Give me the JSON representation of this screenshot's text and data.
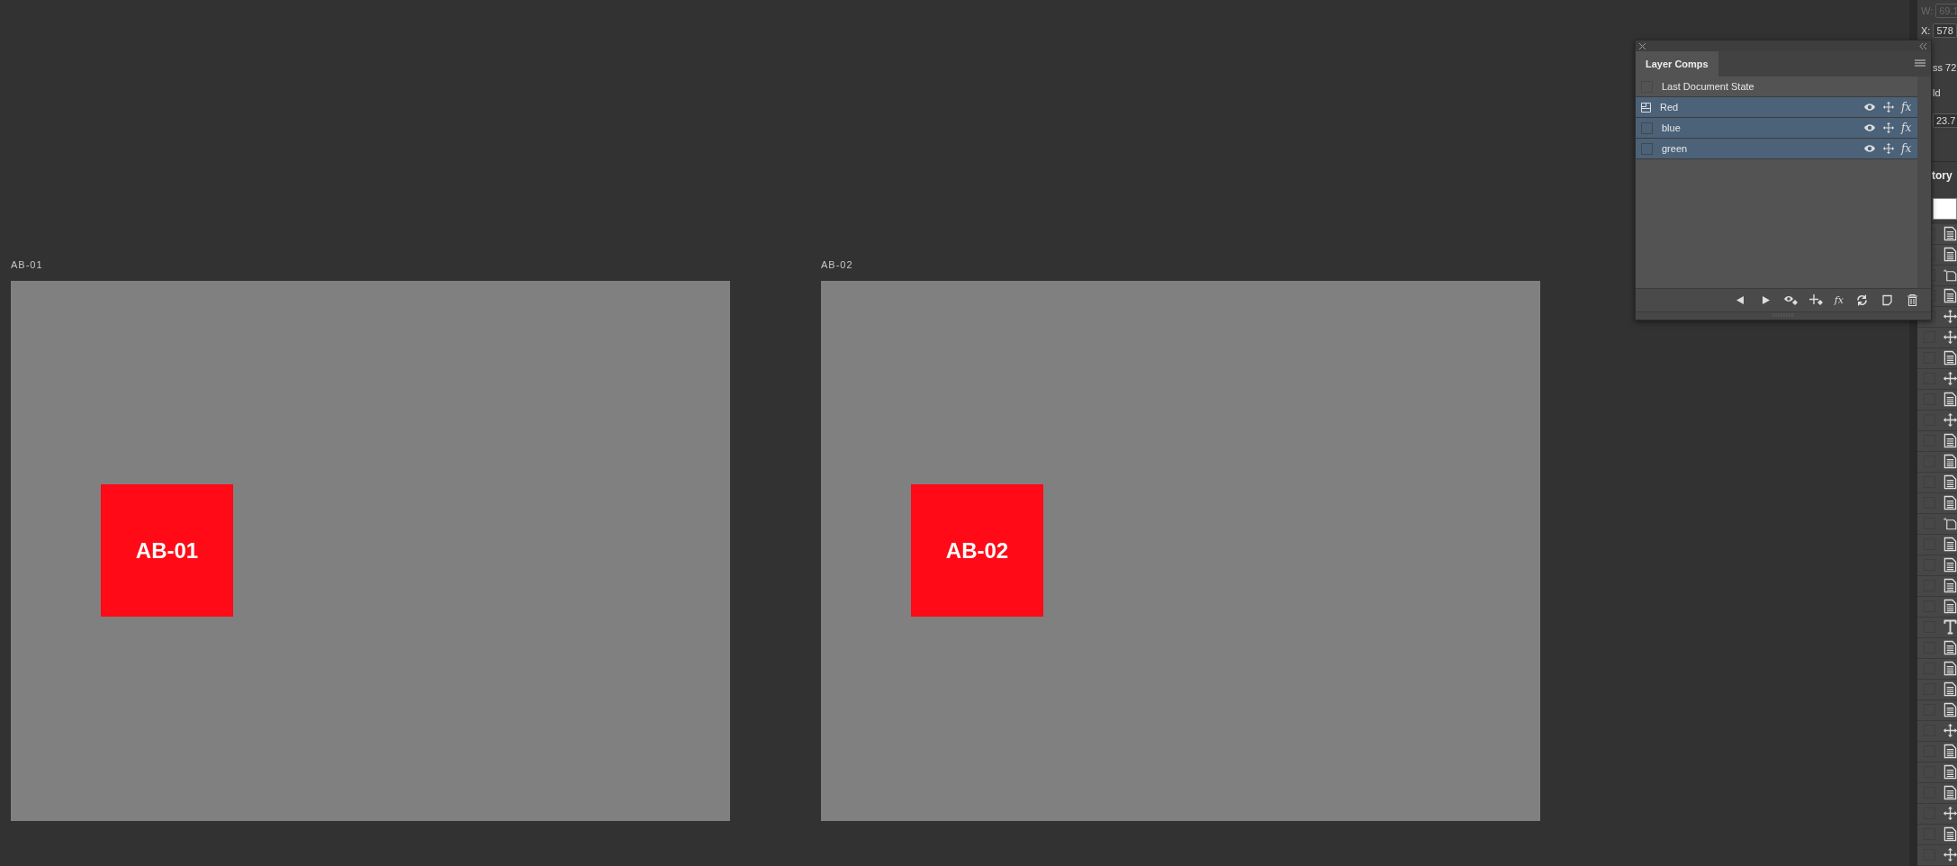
{
  "artboards": [
    {
      "label": "AB-01",
      "layer_text": "AB-01"
    },
    {
      "label": "AB-02",
      "layer_text": "AB-02"
    }
  ],
  "layer_comps_panel": {
    "tab": "Layer Comps",
    "footer_fx": "fx",
    "comps": [
      {
        "kind": "document_state",
        "name": "Last Document State",
        "selected": false,
        "applied": false
      },
      {
        "kind": "comp",
        "name": "Red",
        "selected": true,
        "applied": true,
        "fx": "fx"
      },
      {
        "kind": "comp",
        "name": "blue",
        "selected": true,
        "applied": false,
        "fx": "fx"
      },
      {
        "kind": "comp",
        "name": "green",
        "selected": true,
        "applied": false,
        "fx": "fx"
      }
    ]
  },
  "side_panel": {
    "w_label": "W:",
    "w_value": "69.1",
    "x_label": "X:",
    "x_value": "578",
    "font_fragment": "ss 72",
    "style_fragment": "ld",
    "size_value": "23.7",
    "history_title": "tory",
    "history": [
      {
        "kind": "document",
        "checked": false
      },
      {
        "kind": "document",
        "checked": false
      },
      {
        "kind": "new",
        "checked": false
      },
      {
        "kind": "document",
        "checked": false
      },
      {
        "kind": "move",
        "checked": false
      },
      {
        "kind": "move",
        "checked": false
      },
      {
        "kind": "document",
        "checked": false
      },
      {
        "kind": "move",
        "checked": false
      },
      {
        "kind": "document",
        "checked": false
      },
      {
        "kind": "move",
        "checked": false
      },
      {
        "kind": "document",
        "checked": false
      },
      {
        "kind": "document",
        "checked": false
      },
      {
        "kind": "document",
        "checked": false
      },
      {
        "kind": "document",
        "checked": false
      },
      {
        "kind": "new",
        "checked": false
      },
      {
        "kind": "document",
        "checked": false
      },
      {
        "kind": "document",
        "checked": false
      },
      {
        "kind": "document",
        "checked": false
      },
      {
        "kind": "document",
        "checked": false
      },
      {
        "kind": "type",
        "checked": false
      },
      {
        "kind": "document",
        "checked": false
      },
      {
        "kind": "document",
        "checked": false
      },
      {
        "kind": "document",
        "checked": false
      },
      {
        "kind": "document",
        "checked": false
      },
      {
        "kind": "move",
        "checked": false
      },
      {
        "kind": "document",
        "checked": false
      },
      {
        "kind": "document",
        "checked": false
      },
      {
        "kind": "document",
        "checked": false
      },
      {
        "kind": "move",
        "checked": false
      },
      {
        "kind": "document",
        "checked": false
      },
      {
        "kind": "move",
        "checked": false
      }
    ]
  }
}
